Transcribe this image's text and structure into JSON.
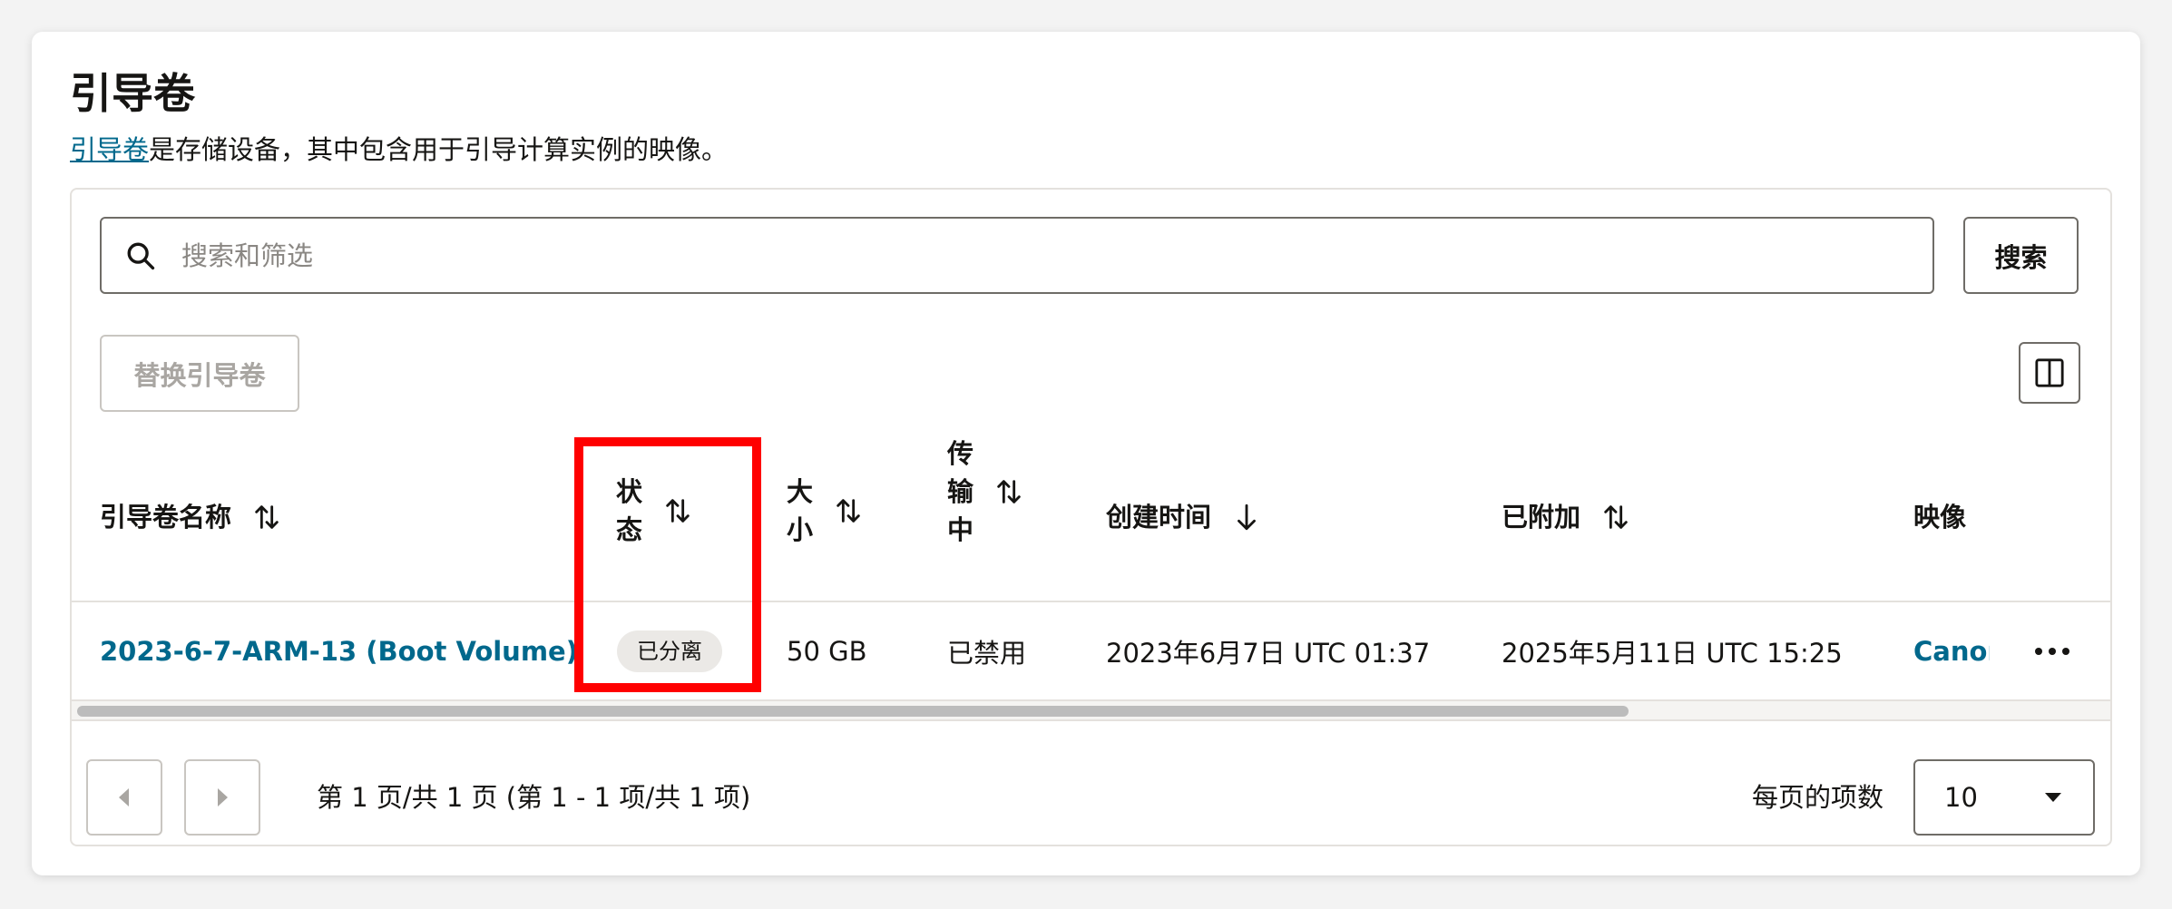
{
  "page": {
    "title": "引导卷",
    "description_link": "引导卷",
    "description_rest": "是存储设备，其中包含用于引导计算实例的映像。"
  },
  "toolbar": {
    "search_placeholder": "搜索和筛选",
    "search_button": "搜索",
    "replace_button": "替换引导卷"
  },
  "table": {
    "columns": [
      {
        "label": "引导卷名称",
        "sort": "both"
      },
      {
        "label": "状\n态",
        "sort": "both"
      },
      {
        "label": "大\n小",
        "sort": "both"
      },
      {
        "label": "传\n输\n中",
        "sort": "both"
      },
      {
        "label": "创建时间",
        "sort": "desc"
      },
      {
        "label": "已附加",
        "sort": "both"
      },
      {
        "label": "映像",
        "sort": "none"
      }
    ],
    "rows": [
      {
        "name": "2023-6-7-ARM-13 (Boot Volume)",
        "status": "已分离",
        "size": "50 GB",
        "in_transit": "已禁用",
        "created": "2023年6月7日 UTC 01:37",
        "attached": "2025年5月11日 UTC 15:25",
        "image": "Canon"
      }
    ]
  },
  "pagination": {
    "info": "第 1 页/共 1 页 (第 1 - 1 项/共 1 项)",
    "per_page_label": "每页的项数",
    "per_page_value": "10"
  },
  "colors": {
    "link": "#00688c",
    "highlight": "#ff0000",
    "badge_bg": "#ebe9e6"
  }
}
